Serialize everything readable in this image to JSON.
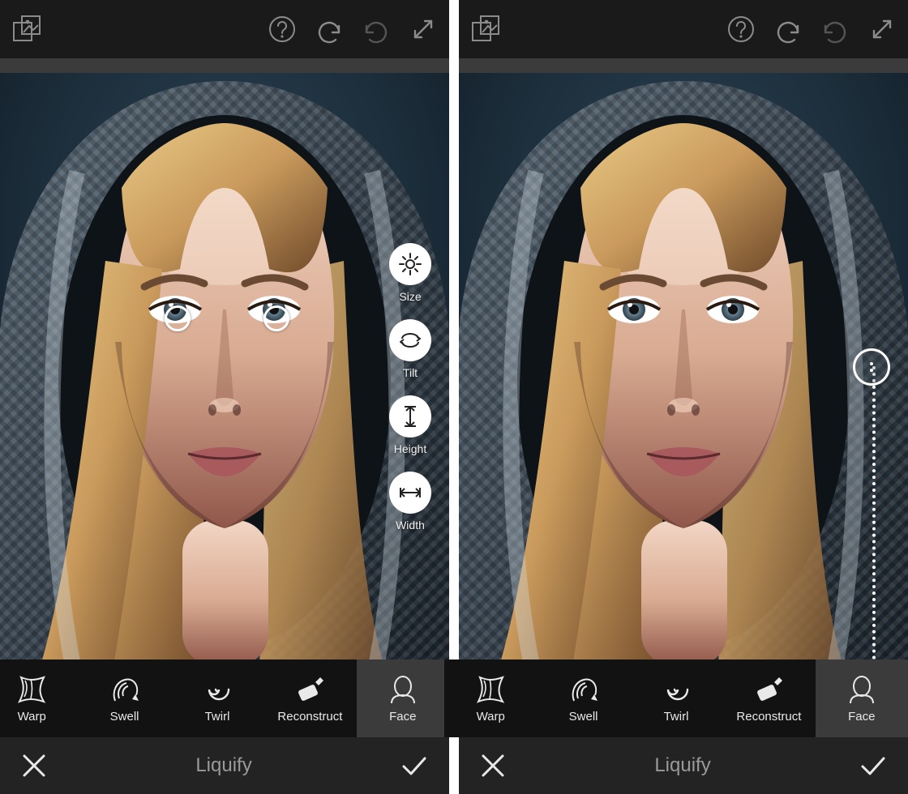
{
  "footer_title": "Liquify",
  "face_options": [
    {
      "name": "size",
      "label": "Size"
    },
    {
      "name": "tilt",
      "label": "Tilt"
    },
    {
      "name": "height",
      "label": "Height"
    },
    {
      "name": "width",
      "label": "Width"
    }
  ],
  "tools": [
    {
      "name": "warp",
      "label": "Warp",
      "active": false
    },
    {
      "name": "swell",
      "label": "Swell",
      "active": false
    },
    {
      "name": "twirl",
      "label": "Twirl",
      "active": false
    },
    {
      "name": "reconstruct",
      "label": "Reconstruct",
      "active": false
    },
    {
      "name": "face",
      "label": "Face",
      "active": true
    }
  ],
  "colors": {
    "toolbar_bg": "#1a1a1a",
    "substrip": "#3b3b3b",
    "tool_bg": "#121212",
    "tool_active": "#3b3b3b",
    "footer_bg": "#232323",
    "footer_text": "#9a9a9a",
    "accent": "#ffffff"
  }
}
